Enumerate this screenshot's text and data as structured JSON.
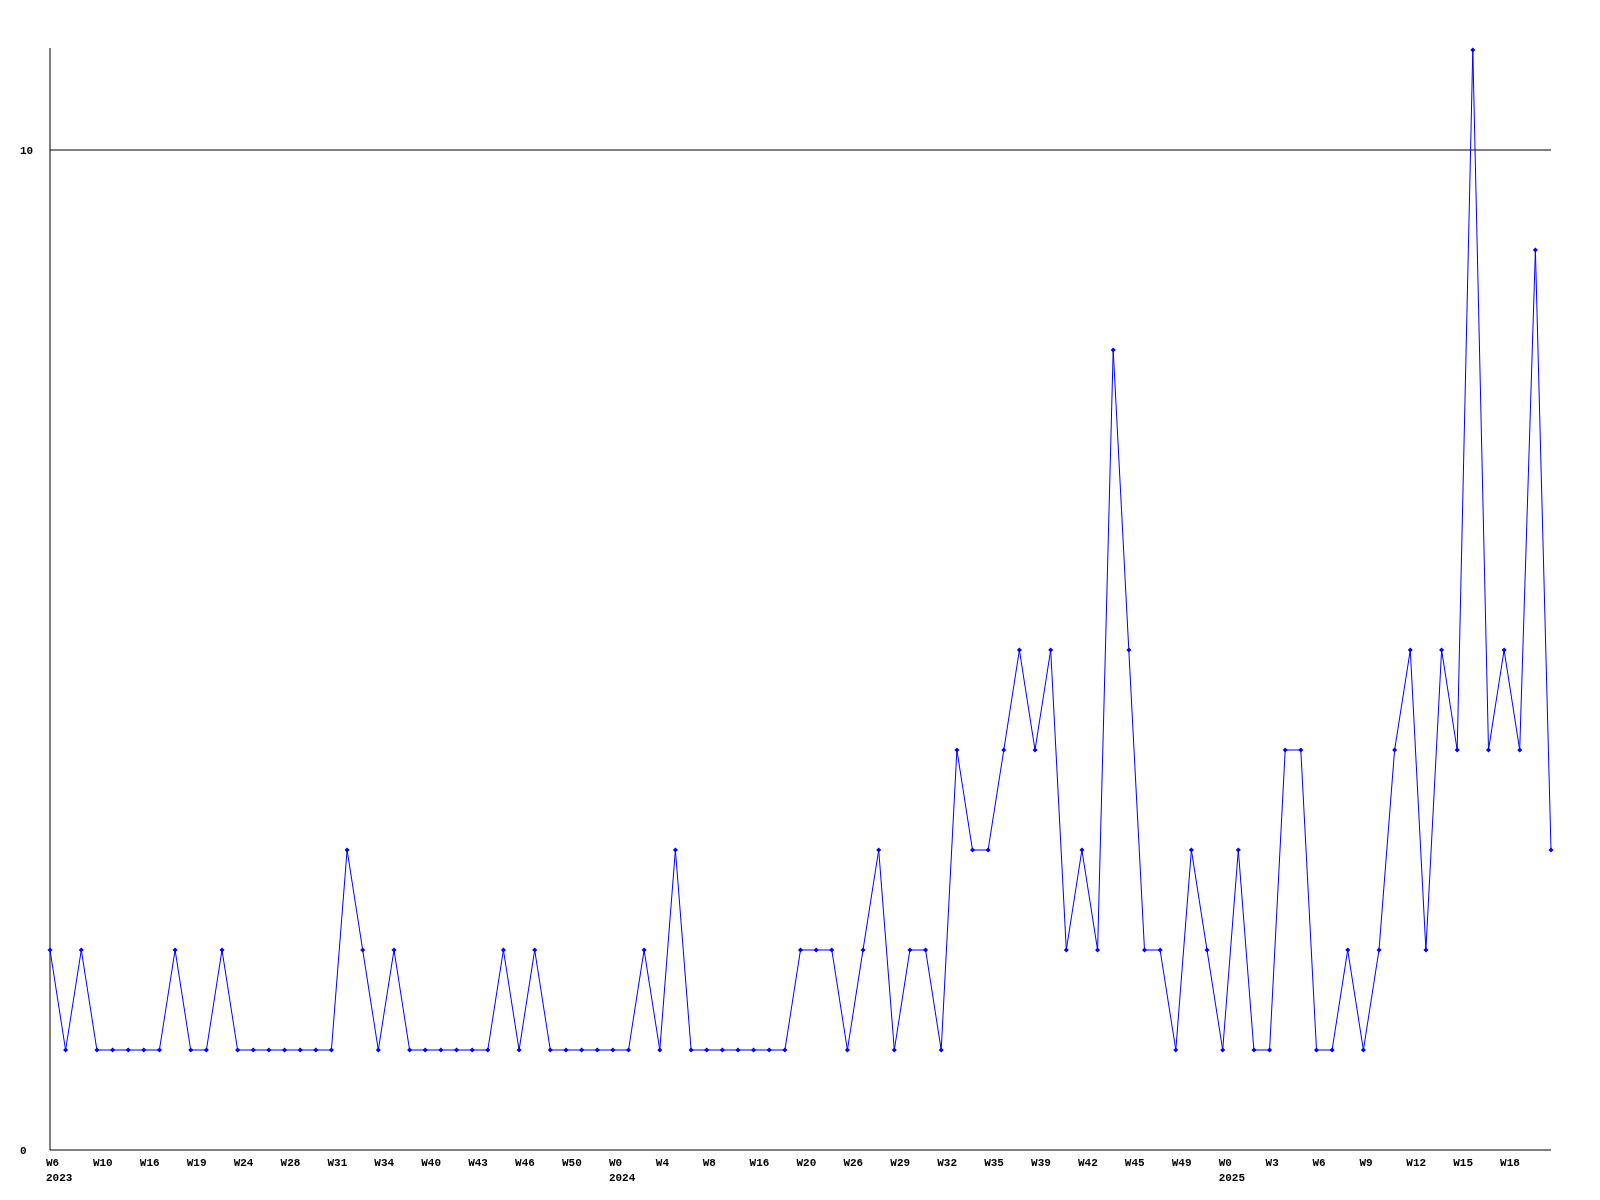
{
  "chart_data": {
    "type": "line",
    "categories": [
      "W6\n2023",
      null,
      null,
      "W10",
      null,
      null,
      "W16",
      null,
      null,
      "W19",
      null,
      null,
      "W24",
      null,
      null,
      "W28",
      null,
      null,
      "W31",
      null,
      null,
      "W34",
      null,
      null,
      "W40",
      null,
      null,
      "W43",
      null,
      null,
      "W46",
      null,
      null,
      "W50",
      null,
      null,
      "W0\n2024",
      null,
      null,
      "W4",
      null,
      null,
      "W8",
      null,
      null,
      "W16",
      null,
      null,
      "W20",
      null,
      null,
      "W26",
      null,
      null,
      "W29",
      null,
      null,
      "W32",
      null,
      null,
      "W35",
      null,
      null,
      "W39",
      null,
      null,
      "W42",
      null,
      null,
      "W45",
      null,
      null,
      "W49",
      null,
      null,
      "W0\n2025",
      null,
      null,
      "W3",
      null,
      null,
      "W6",
      null,
      null,
      "W9",
      null,
      null,
      "W12",
      null,
      null,
      "W15",
      null,
      null,
      "W18",
      null,
      null,
      null
    ],
    "series": [
      {
        "color": "#0000ff",
        "marker": "diamond",
        "values": [
          2,
          1,
          2,
          1,
          1,
          1,
          1,
          1,
          2,
          1,
          1,
          2,
          1,
          1,
          1,
          1,
          1,
          1,
          1,
          3,
          2,
          1,
          2,
          1,
          1,
          1,
          1,
          1,
          1,
          2,
          1,
          2,
          1,
          1,
          1,
          1,
          1,
          1,
          2,
          1,
          3,
          1,
          1,
          1,
          1,
          1,
          1,
          1,
          2,
          2,
          2,
          1,
          2,
          3,
          1,
          2,
          2,
          1,
          4,
          3,
          3,
          4,
          5,
          4,
          5,
          2,
          3,
          2,
          8,
          5,
          2,
          2,
          1,
          3,
          2,
          1,
          3,
          1,
          1,
          4,
          4,
          1,
          1,
          2,
          1,
          2,
          4,
          5,
          2,
          5,
          4,
          11,
          4,
          5,
          4,
          9,
          3
        ]
      }
    ],
    "ylim": [
      0,
      11
    ],
    "yticks": [
      0,
      10
    ]
  }
}
